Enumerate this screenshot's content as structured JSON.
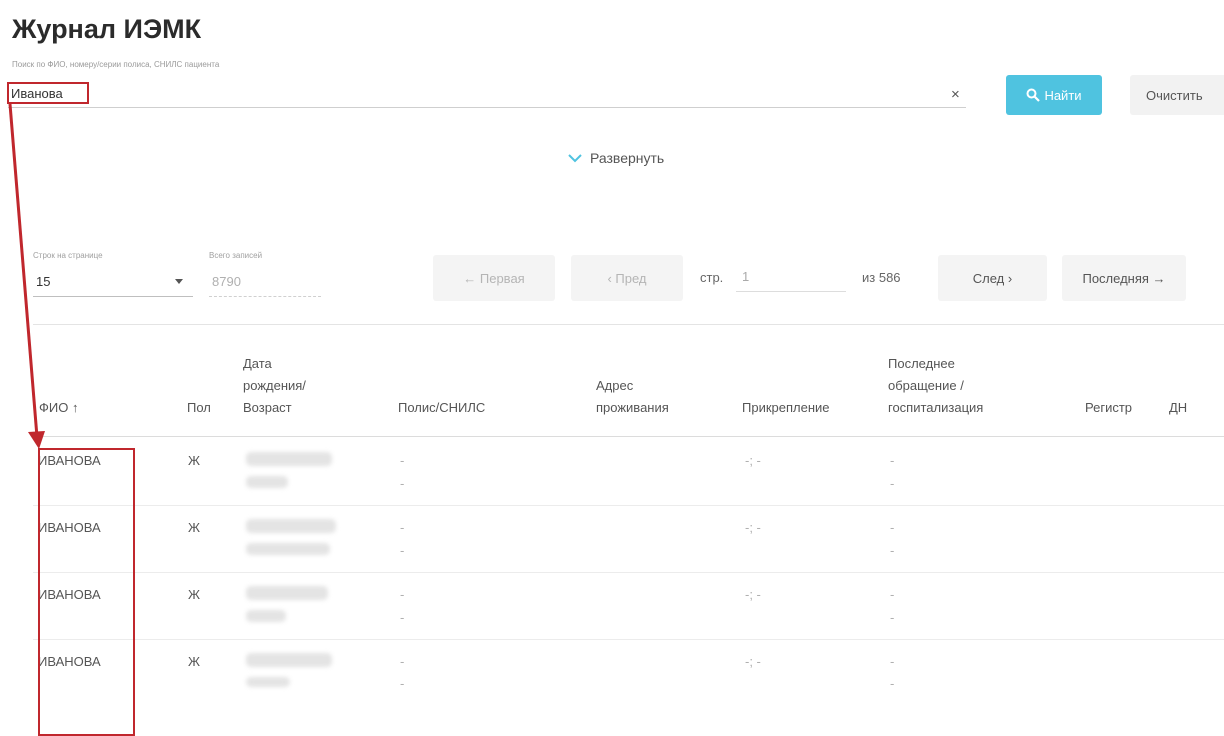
{
  "page": {
    "title": "Журнал ИЭМК"
  },
  "search": {
    "label": "Поиск по ФИО, номеру/серии полиса, СНИЛС пациента",
    "value": "Иванова",
    "clear_icon": "×",
    "find_label": "Найти",
    "clear_label": "Очистить"
  },
  "expand": {
    "label": "Развернуть"
  },
  "pagination": {
    "rows_per_page_label": "Строк на странице",
    "rows_per_page": "15",
    "total_label": "Всего записей",
    "total": "8790",
    "first": "← Первая",
    "prev": "‹ Пред",
    "page_label": "стр.",
    "page": "1",
    "of_pages": "из 586",
    "next": "След ›",
    "last": "Последняя →"
  },
  "table": {
    "columns": {
      "fio": "ФИО ↑",
      "sex": "Пол",
      "dob": [
        "Дата",
        "рождения/",
        "Возраст"
      ],
      "policy": "Полис/СНИЛС",
      "address": [
        "Адрес",
        "проживания"
      ],
      "attachment": "Прикрепление",
      "last_visit": [
        "Последнее",
        "обращение /",
        "госпитализация"
      ],
      "registry": "Регистр",
      "dn": "ДН"
    },
    "rows": [
      {
        "fio": "ИВАНОВА",
        "sex": "Ж",
        "policy_1": "-",
        "policy_2": "-",
        "attachment": "-; -",
        "last_1": "-",
        "last_2": "-"
      },
      {
        "fio": "ИВАНОВА",
        "sex": "Ж",
        "policy_1": "-",
        "policy_2": "-",
        "attachment": "-; -",
        "last_1": "-",
        "last_2": "-"
      },
      {
        "fio": "ИВАНОВА",
        "sex": "Ж",
        "policy_1": "-",
        "policy_2": "-",
        "attachment": "-; -",
        "last_1": "-",
        "last_2": "-"
      },
      {
        "fio": "ИВАНОВА",
        "sex": "Ж",
        "policy_1": "-",
        "policy_2": "-",
        "attachment": "-; -",
        "last_1": "-",
        "last_2": "-"
      }
    ]
  },
  "colors": {
    "accent": "#4fc3e0",
    "annotation": "#c0272d"
  }
}
